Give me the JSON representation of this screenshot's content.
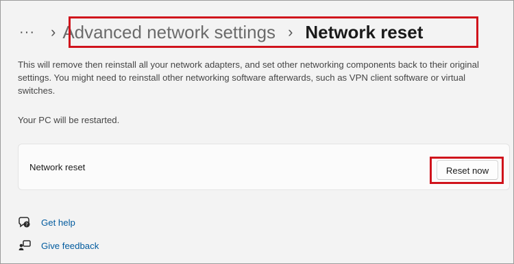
{
  "breadcrumb": {
    "more_label": "···",
    "separator": "›",
    "parent": "Advanced network settings",
    "current": "Network reset"
  },
  "description": "This will remove then reinstall all your network adapters, and set other networking components back to their original settings. You might need to reinstall other networking software afterwards, such as VPN client software or virtual switches.",
  "restart_note": "Your PC will be restarted.",
  "card": {
    "label": "Network reset",
    "button_label": "Reset now"
  },
  "links": {
    "help": {
      "label": "Get help",
      "icon": "help-icon"
    },
    "feedback": {
      "label": "Give feedback",
      "icon": "feedback-icon"
    }
  },
  "colors": {
    "highlight": "#d0121b",
    "link": "#005a9e",
    "background": "#f3f3f3"
  }
}
